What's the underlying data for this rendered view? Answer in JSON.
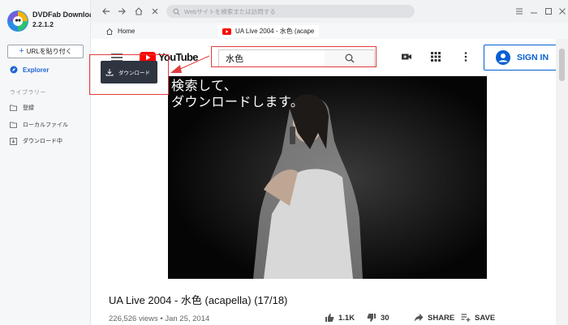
{
  "app": {
    "name": "DVDFab Downloader",
    "version": "2.2.1.2"
  },
  "sidebar": {
    "add_url_label": "URLを貼り付く",
    "explorer_label": "Explorer",
    "library_label": "ライブラリー",
    "items": [
      {
        "label": "登録",
        "icon": "folder-icon"
      },
      {
        "label": "ローカルファイル",
        "icon": "folder-icon"
      },
      {
        "label": "ダウンロード中",
        "icon": "download-icon"
      }
    ]
  },
  "browser": {
    "address_placeholder": "Webサイトを検索または訪問する",
    "tabs": [
      {
        "label": "Home",
        "icon": "home-icon"
      },
      {
        "label": "UA Live 2004 - 水色 (acape",
        "icon": "youtube-icon"
      }
    ]
  },
  "youtube": {
    "logo_text": "YouTube",
    "search_value": "水色",
    "signin_label": "SIGN IN"
  },
  "video": {
    "caption": "検索して、\nダウンロードします。",
    "title": "UA Live 2004 - 水色 (acapella) (17/18)",
    "meta": "226,526 views • Jan 25, 2014",
    "actions": [
      {
        "label": "1.1K",
        "icon": "thumbs-up-icon"
      },
      {
        "label": "30",
        "icon": "thumbs-down-icon"
      },
      {
        "label": "SHARE",
        "icon": "share-icon"
      },
      {
        "label": "SAVE",
        "icon": "save-icon"
      }
    ]
  },
  "overlay": {
    "download_label": "ダウンロード"
  },
  "colors": {
    "accent": "#1f64d6",
    "youtube_red": "#ff0000",
    "highlight": "#e23b3b",
    "signin_blue": "#065fd4"
  }
}
